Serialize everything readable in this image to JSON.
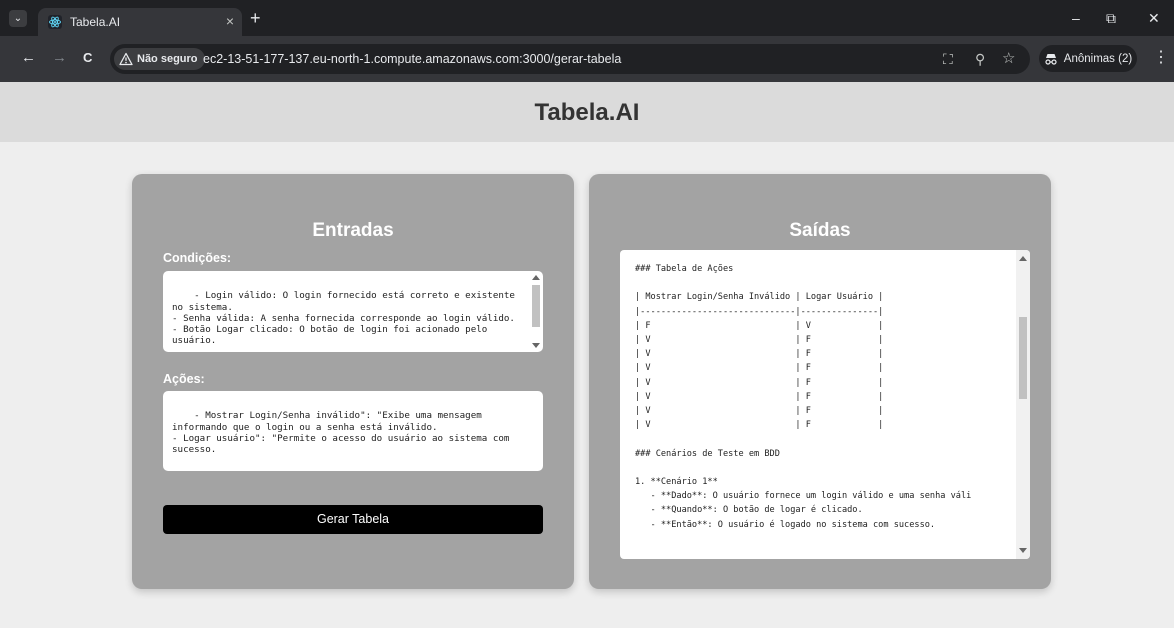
{
  "browser": {
    "tab": {
      "title": "Tabela.AI",
      "close": "×"
    },
    "new_tab": "+",
    "window": {
      "minimize": "–",
      "restore": "⧉",
      "close": "✕"
    },
    "nav": {
      "back": "←",
      "forward": "→",
      "reload": "C"
    },
    "security_label": "Não seguro",
    "url": "ec2-13-51-177-137.eu-north-1.compute.amazonaws.com:3000/gerar-tabela",
    "omnibox_icons": {
      "translate": "⛶",
      "zoom": "⚲",
      "bookmark": "☆"
    },
    "incognito_label": "Anônimas (2)",
    "menu": "⋮"
  },
  "page": {
    "title": "Tabela.AI"
  },
  "inputs": {
    "title": "Entradas",
    "conditions_label": "Condições:",
    "conditions_text": "- Login válido: O login fornecido está correto e existente no sistema.\n- Senha válida: A senha fornecida corresponde ao login válido.\n- Botão Logar clicado: O botão de login foi acionado pelo usuário.",
    "actions_label": "Ações:",
    "actions_text": "- Mostrar Login/Senha inválido\": \"Exibe uma mensagem informando que o login ou a senha está inválido.\n- Logar usuário\": \"Permite o acesso do usuário ao sistema com sucesso.",
    "button_label": "Gerar Tabela"
  },
  "outputs": {
    "title": "Saídas",
    "text": "### Tabela de Ações\n\n| Mostrar Login/Senha Inválido | Logar Usuário |\n|------------------------------|---------------|\n| F                            | V             |\n| V                            | F             |\n| V                            | F             |\n| V                            | F             |\n| V                            | F             |\n| V                            | F             |\n| V                            | F             |\n| V                            | F             |\n\n### Cenários de Teste em BDD\n\n1. **Cenário 1**\n   - **Dado**: O usuário fornece um login válido e uma senha váli\n   - **Quando**: O botão de logar é clicado.\n   - **Então**: O usuário é logado no sistema com sucesso."
  },
  "colors": {
    "header_bg": "#dbdbdb",
    "panel_bg": "#a3a3a3",
    "button_bg": "#000000",
    "page_bg": "#eeeeee"
  }
}
